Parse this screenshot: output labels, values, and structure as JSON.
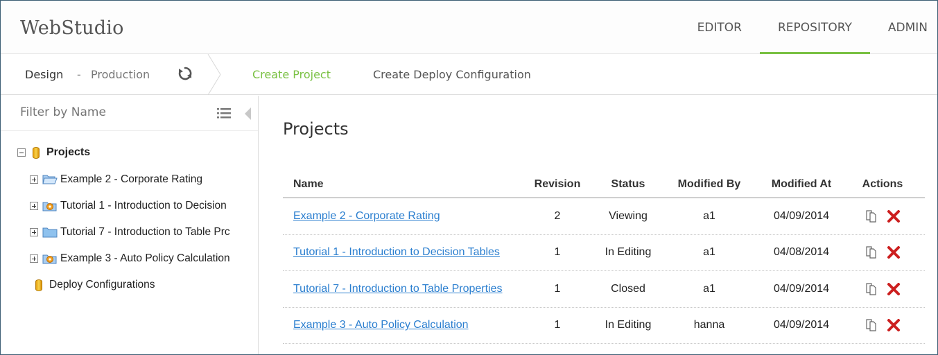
{
  "app": {
    "logo": "WebStudio"
  },
  "nav": {
    "editor": "EDITOR",
    "repository": "REPOSITORY",
    "admin": "ADMIN"
  },
  "subbar": {
    "design": "Design",
    "separator": "-",
    "production": "Production",
    "create_project": "Create Project",
    "create_deploy": "Create Deploy Configuration"
  },
  "sidebar": {
    "filter_placeholder": "Filter by Name",
    "root": "Projects",
    "items": [
      {
        "label": "Example 2 - Corporate Rating"
      },
      {
        "label": "Tutorial 1 - Introduction to Decision"
      },
      {
        "label": "Tutorial 7 - Introduction to Table Prc"
      },
      {
        "label": "Example 3 - Auto Policy Calculation"
      }
    ],
    "deploy": "Deploy Configurations"
  },
  "main": {
    "title": "Projects",
    "columns": {
      "name": "Name",
      "revision": "Revision",
      "status": "Status",
      "modified_by": "Modified By",
      "modified_at": "Modified At",
      "actions": "Actions"
    },
    "rows": [
      {
        "name": "Example 2 - Corporate Rating",
        "revision": "2",
        "status": "Viewing",
        "modified_by": "a1",
        "modified_at": "04/09/2014"
      },
      {
        "name": "Tutorial 1 - Introduction to Decision Tables",
        "revision": "1",
        "status": "In Editing",
        "modified_by": "a1",
        "modified_at": "04/08/2014"
      },
      {
        "name": "Tutorial 7 - Introduction to Table Properties",
        "revision": "1",
        "status": "Closed",
        "modified_by": "a1",
        "modified_at": "04/09/2014"
      },
      {
        "name": "Example 3 - Auto Policy Calculation",
        "revision": "1",
        "status": "In Editing",
        "modified_by": "hanna",
        "modified_at": "04/09/2014"
      }
    ]
  },
  "colors": {
    "accent": "#7ac143",
    "link": "#2a7ecf",
    "delete": "#cc1f1f"
  },
  "icons": [
    "refresh-icon",
    "list-icon",
    "collapse-arrow-icon",
    "database-icon",
    "folder-icon",
    "copy-icon",
    "delete-icon"
  ]
}
